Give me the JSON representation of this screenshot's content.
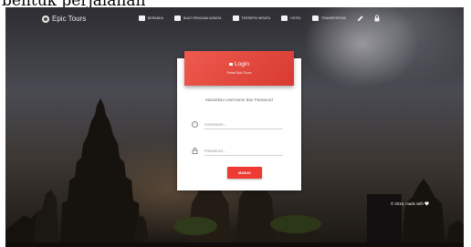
{
  "page_caption": "bentuk perjalanan",
  "app": {
    "brand": "Epic Tours"
  },
  "nav": {
    "items": [
      {
        "label": "BERANDA",
        "icon": "home-icon"
      },
      {
        "label": "BUAT RENCANA WISATA",
        "icon": "calendar-icon"
      },
      {
        "label": "TERSEPKI WISATA",
        "icon": "mountain-icon"
      },
      {
        "label": "HOTEL",
        "icon": "bed-icon"
      },
      {
        "label": "TRANSPORTASI",
        "icon": "bus-icon"
      }
    ],
    "extra_icons": [
      "pencil-icon",
      "lock-icon"
    ]
  },
  "login": {
    "title": "Login",
    "subtitle": "Portal Epic Tours",
    "description": "Masukkan Username dan Password",
    "username_placeholder": "Username...",
    "password_placeholder": "Password...",
    "button_label": "MASUK"
  },
  "footer": {
    "text": "© 2016, made with"
  },
  "colors": {
    "accent": "#e8483e",
    "button": "#ee3a32",
    "card": "#ffffff"
  }
}
